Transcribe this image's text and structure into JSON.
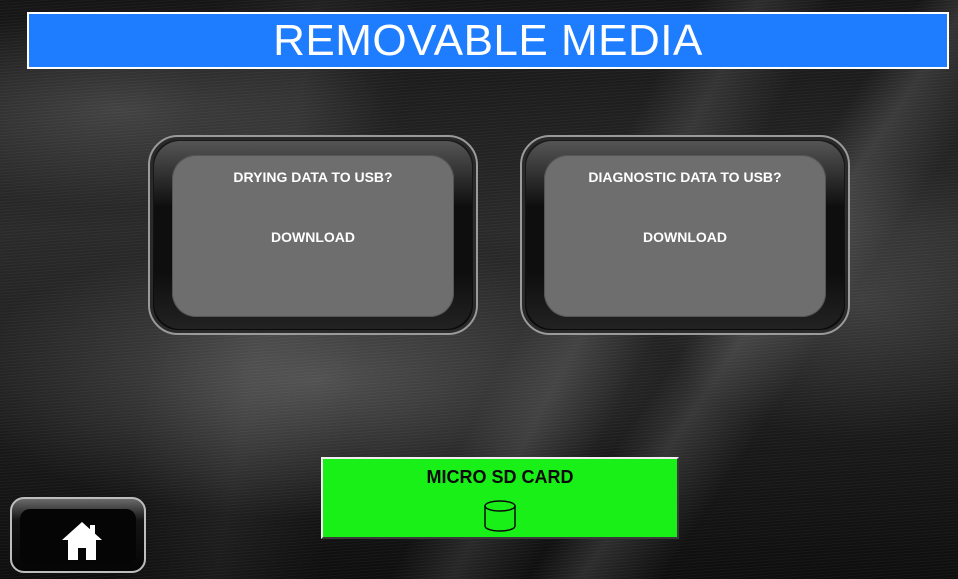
{
  "header": {
    "title": "REMOVABLE MEDIA"
  },
  "panels": [
    {
      "question": "DRYING DATA TO USB?",
      "action": "DOWNLOAD"
    },
    {
      "question": "DIAGNOSTIC DATA TO USB?",
      "action": "DOWNLOAD"
    }
  ],
  "sd_button": {
    "label": "MICRO SD CARD",
    "icon": "database-icon"
  },
  "home_button": {
    "icon": "home-icon"
  },
  "colors": {
    "title_bar": "#1e7dff",
    "sd_button": "#18f018",
    "panel_face": "#6e6e6e"
  }
}
